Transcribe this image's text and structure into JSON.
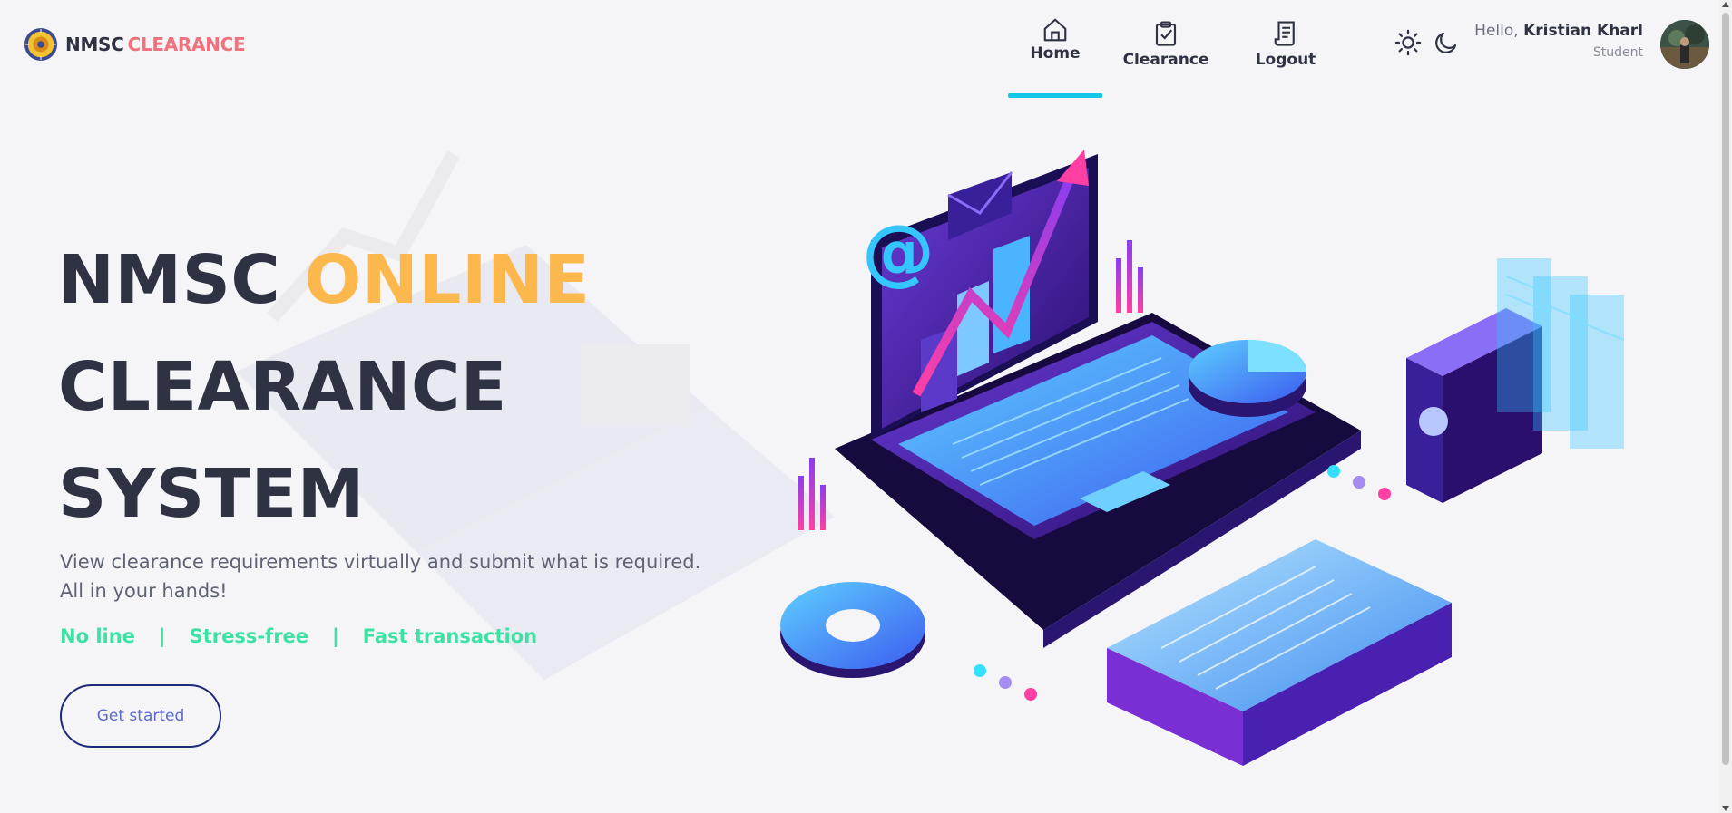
{
  "brand": {
    "prefix": "NMSC",
    "suffix": "CLEARANCE"
  },
  "nav": {
    "home": "Home",
    "clearance": "Clearance",
    "logout": "Logout"
  },
  "user": {
    "hello": "Hello,",
    "name": "Kristian Kharl",
    "role": "Student"
  },
  "hero": {
    "title_part1": "NMSC",
    "title_accent": "ONLINE",
    "title_line2": "CLEARANCE",
    "title_line3": "SYSTEM",
    "subtitle_line1": "View clearance requirements virtually and submit what is required.",
    "subtitle_line2": "All in your hands!",
    "tags": [
      "No line",
      "Stress-free",
      "Fast transaction"
    ],
    "tag_separator": "|",
    "cta": "Get started"
  },
  "colors": {
    "accent_orange": "#fdb84d",
    "brand_pink": "#f0727c",
    "tag_green": "#3de1a4",
    "active_tab": "#14c7e8",
    "text_dark": "#2f3243"
  },
  "icons": {
    "home": "home-icon",
    "clearance": "clipboard-check-icon",
    "logout": "receipt-icon",
    "light_mode": "sun-icon",
    "dark_mode": "moon-icon"
  }
}
